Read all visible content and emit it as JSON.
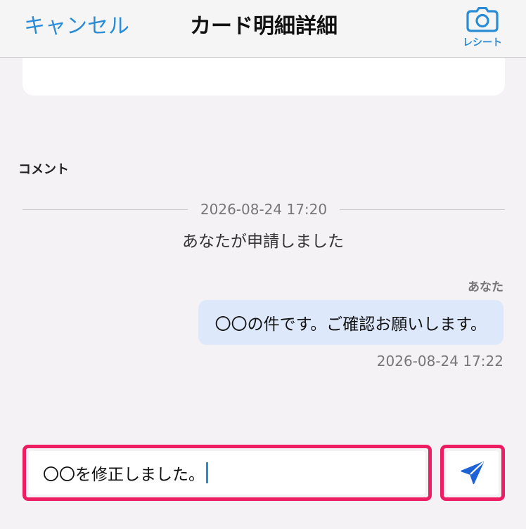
{
  "navbar": {
    "cancel_label": "キャンセル",
    "title": "カード明細詳細",
    "receipt_label": "レシート",
    "receipt_icon": "camera-icon"
  },
  "comments": {
    "section_label": "コメント",
    "divider_time": "2026-08-24 17:20",
    "system_message": "あなたが申請しました",
    "message": {
      "sender": "あなた",
      "text": "〇〇の件です。ご確認お願いします。",
      "time": "2026-08-24 17:22"
    }
  },
  "composer": {
    "input_value": "〇〇を修正しました。",
    "send_icon": "send-icon"
  },
  "colors": {
    "accent": "#2b8cd6",
    "highlight_border": "#ee1e63",
    "bubble_bg": "#dde8fb",
    "send_icon": "#1e63d6"
  }
}
